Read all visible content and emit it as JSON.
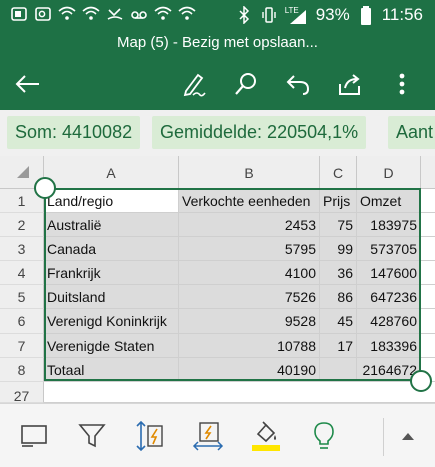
{
  "status_bar": {
    "battery": "93%",
    "time": "11:56",
    "network": "LTE"
  },
  "window_title": "Map (5) - Bezig met opslaan...",
  "toolbar": {
    "icons": [
      "back-arrow-icon",
      "draw-pen-icon",
      "search-icon",
      "undo-icon",
      "share-icon",
      "more-options-icon"
    ]
  },
  "summary": {
    "sum": "Som: 4410082",
    "average": "Gemiddelde: 220504,1%",
    "count": "Aant"
  },
  "sheet": {
    "columns": [
      "A",
      "B",
      "C",
      "D"
    ],
    "rows": [
      {
        "num": "1",
        "cells": [
          "Land/regio",
          "Verkochte eenheden",
          "Prijs",
          "Omzet"
        ]
      },
      {
        "num": "2",
        "cells": [
          "Australië",
          "2453",
          "75",
          "183975"
        ]
      },
      {
        "num": "3",
        "cells": [
          "Canada",
          "5795",
          "99",
          "573705"
        ]
      },
      {
        "num": "4",
        "cells": [
          "Frankrijk",
          "4100",
          "36",
          "147600"
        ]
      },
      {
        "num": "5",
        "cells": [
          "Duitsland",
          "7526",
          "86",
          "647236"
        ]
      },
      {
        "num": "6",
        "cells": [
          "Verenigd Koninkrijk",
          "9528",
          "45",
          "428760"
        ]
      },
      {
        "num": "7",
        "cells": [
          "Verenigde Staten",
          "10788",
          "17",
          "183396"
        ]
      },
      {
        "num": "8",
        "cells": [
          "Totaal",
          "40190",
          "",
          "2164672"
        ]
      }
    ],
    "extra_row": "27"
  },
  "bottom_bar": {
    "icons": [
      "select-table-icon",
      "filter-icon",
      "sort-icon",
      "flash-fill-icon",
      "fill-color-icon",
      "ideas-lightbulb-icon",
      "expand-up-icon"
    ],
    "fill_color": "#ffe600"
  },
  "colors": {
    "brand": "#1e7145",
    "chip_bg": "#d9ecd5",
    "chip_text": "#1e6a3c",
    "selection": "#217346"
  }
}
